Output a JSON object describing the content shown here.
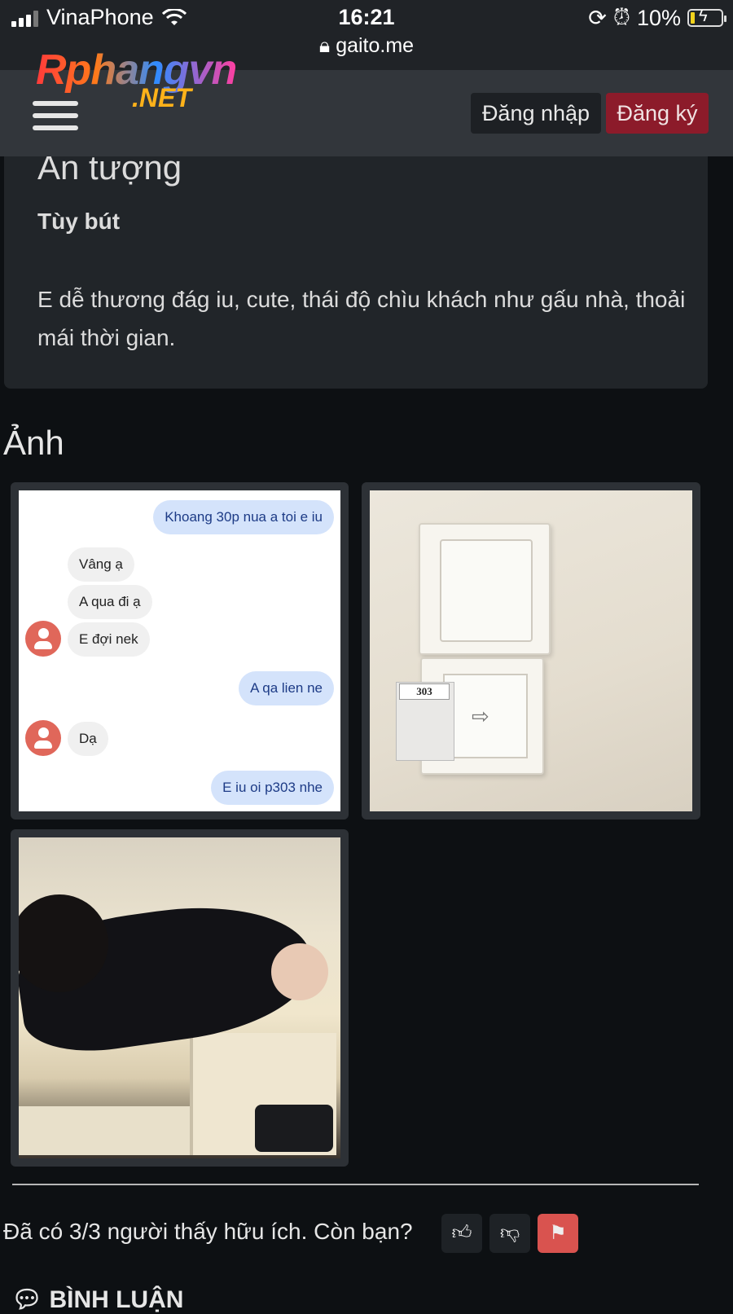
{
  "status_bar": {
    "carrier": "VinaPhone",
    "time": "16:21",
    "url": "gaito.me",
    "battery": "10%",
    "battery_level": 0.1
  },
  "header": {
    "logo_main": "Rphangvn",
    "logo_sub": ".NET",
    "login_label": "Đăng nhập",
    "register_label": "Đăng ký",
    "colors": {
      "header_bg": "#32363b",
      "register_bg": "#8c1b2a"
    }
  },
  "review": {
    "heading": "Ấn tượng",
    "category": "Tùy bút",
    "text": "E dễ thương đág iu, cute, thái độ chìu khách như gấu nhà, thoải mái thời gian."
  },
  "photos": {
    "section_title": "Ảnh",
    "chat": [
      {
        "dir": "out",
        "text": "Khoang 30p nua a toi e iu"
      },
      {
        "dir": "in",
        "text": "Vâng ạ"
      },
      {
        "dir": "in",
        "text": "A qua đi ạ"
      },
      {
        "dir": "in",
        "text": "E đợi nek"
      },
      {
        "dir": "out",
        "text": "A qa lien ne"
      },
      {
        "dir": "in",
        "text": "Dạ"
      },
      {
        "dir": "out",
        "text": "E iu oi p303 nhe"
      }
    ],
    "room_label": "303"
  },
  "feedback": {
    "helpful_text": "Đã có 3/3 người thấy hữu ích. Còn bạn?",
    "like_icon": "thumbs-up-icon",
    "dislike_icon": "thumbs-down-icon",
    "report_icon": "flag-icon",
    "report_color": "#d9534f"
  },
  "comments": {
    "title": "BÌNH LUẬN"
  }
}
